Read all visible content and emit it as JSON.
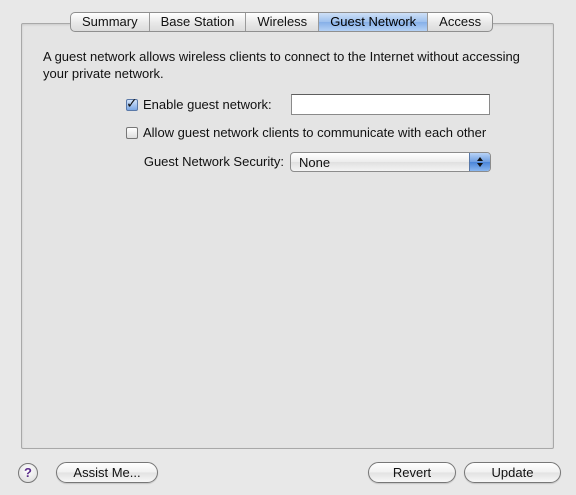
{
  "tabs": [
    {
      "label": "Summary",
      "active": false
    },
    {
      "label": "Base Station",
      "active": false
    },
    {
      "label": "Wireless",
      "active": false
    },
    {
      "label": "Guest Network",
      "active": true
    },
    {
      "label": "Access",
      "active": false
    }
  ],
  "description": "A guest network allows wireless clients to connect to the Internet without accessing your private network.",
  "enable_guest": {
    "label": "Enable guest network:",
    "checked": true,
    "value": "",
    "placeholder": ""
  },
  "allow_communicate": {
    "label": "Allow guest network clients to communicate with each other",
    "checked": false
  },
  "security": {
    "label": "Guest Network Security:",
    "value": "None"
  },
  "footer": {
    "help_label": "?",
    "assist_label": "Assist Me...",
    "revert_label": "Revert",
    "update_label": "Update"
  },
  "colors": {
    "accent": "#86b0e8",
    "background": "#e8e8e8"
  }
}
